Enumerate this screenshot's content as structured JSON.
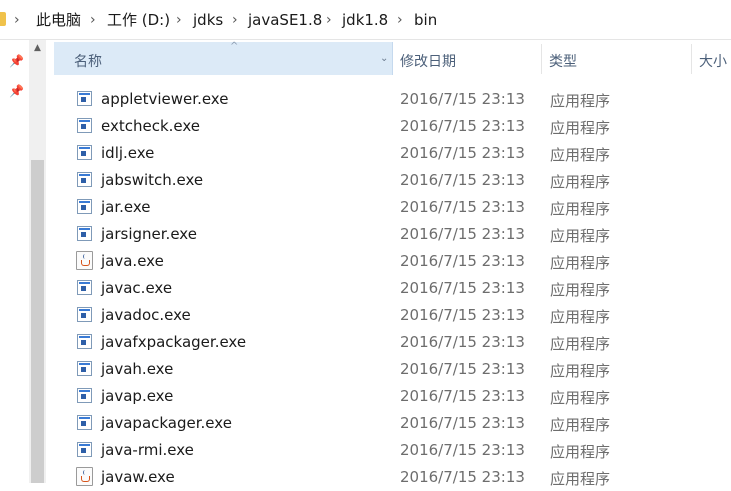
{
  "breadcrumb": {
    "items": [
      "此电脑",
      "工作 (D:)",
      "jdks",
      "javaSE1.8",
      "jdk1.8",
      "bin"
    ],
    "separator": "›"
  },
  "columns": {
    "name": "名称",
    "date": "修改日期",
    "type": "类型",
    "size": "大小"
  },
  "files": [
    {
      "name": "appletviewer.exe",
      "date": "2016/7/15 23:13",
      "type": "应用程序",
      "icon": "exe-icon"
    },
    {
      "name": "extcheck.exe",
      "date": "2016/7/15 23:13",
      "type": "应用程序",
      "icon": "exe-icon"
    },
    {
      "name": "idlj.exe",
      "date": "2016/7/15 23:13",
      "type": "应用程序",
      "icon": "exe-icon"
    },
    {
      "name": "jabswitch.exe",
      "date": "2016/7/15 23:13",
      "type": "应用程序",
      "icon": "exe-icon"
    },
    {
      "name": "jar.exe",
      "date": "2016/7/15 23:13",
      "type": "应用程序",
      "icon": "exe-icon"
    },
    {
      "name": "jarsigner.exe",
      "date": "2016/7/15 23:13",
      "type": "应用程序",
      "icon": "exe-icon"
    },
    {
      "name": "java.exe",
      "date": "2016/7/15 23:13",
      "type": "应用程序",
      "icon": "java-icon"
    },
    {
      "name": "javac.exe",
      "date": "2016/7/15 23:13",
      "type": "应用程序",
      "icon": "exe-icon"
    },
    {
      "name": "javadoc.exe",
      "date": "2016/7/15 23:13",
      "type": "应用程序",
      "icon": "exe-icon"
    },
    {
      "name": "javafxpackager.exe",
      "date": "2016/7/15 23:13",
      "type": "应用程序",
      "icon": "exe-icon"
    },
    {
      "name": "javah.exe",
      "date": "2016/7/15 23:13",
      "type": "应用程序",
      "icon": "exe-icon"
    },
    {
      "name": "javap.exe",
      "date": "2016/7/15 23:13",
      "type": "应用程序",
      "icon": "exe-icon"
    },
    {
      "name": "javapackager.exe",
      "date": "2016/7/15 23:13",
      "type": "应用程序",
      "icon": "exe-icon"
    },
    {
      "name": "java-rmi.exe",
      "date": "2016/7/15 23:13",
      "type": "应用程序",
      "icon": "exe-icon"
    },
    {
      "name": "javaw.exe",
      "date": "2016/7/15 23:13",
      "type": "应用程序",
      "icon": "java-icon"
    }
  ],
  "colors": {
    "header_selected_bg": "#dceaf7",
    "header_text": "#4c607a",
    "secondary_text": "#6d6d6d",
    "folder": "#f0c24b"
  }
}
